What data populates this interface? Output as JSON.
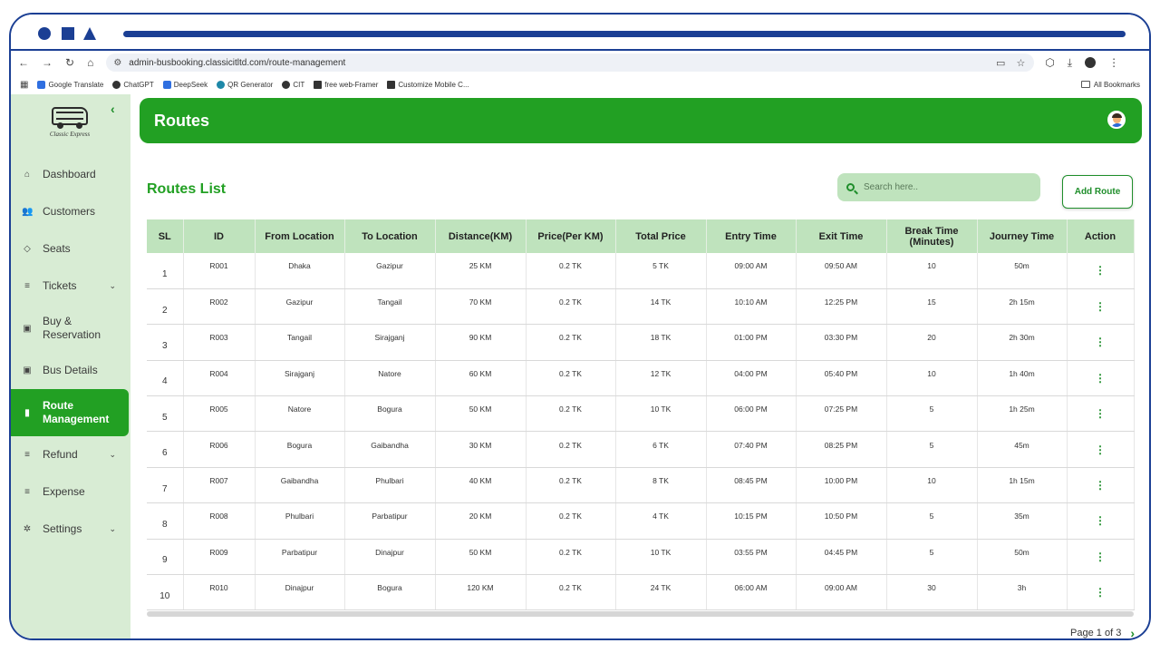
{
  "browser": {
    "url": "admin-busbooking.classicitltd.com/route-management",
    "bookmarks": [
      "Google Translate",
      "ChatGPT",
      "DeepSeek",
      "QR Generator",
      "CIT",
      "free web-Framer",
      "Customize Mobile C..."
    ],
    "all_bookmarks": "All Bookmarks"
  },
  "sidebar": {
    "brand": "Classic Express",
    "items": [
      {
        "label": "Dashboard",
        "icon": "home-icon"
      },
      {
        "label": "Customers",
        "icon": "users-icon"
      },
      {
        "label": "Seats",
        "icon": "layers-icon"
      },
      {
        "label": "Tickets",
        "icon": "list-icon"
      },
      {
        "label": "Buy & Reservation",
        "icon": "bus-icon"
      },
      {
        "label": "Bus Details",
        "icon": "bus-icon"
      },
      {
        "label": "Route Management",
        "icon": "map-icon"
      },
      {
        "label": "Refund",
        "icon": "list-icon"
      },
      {
        "label": "Expense",
        "icon": "list-icon"
      },
      {
        "label": "Settings",
        "icon": "gear-icon"
      }
    ]
  },
  "header": {
    "title": "Routes"
  },
  "main": {
    "list_title": "Routes List",
    "search_placeholder": "Search here..",
    "add_button": "Add Route",
    "pagination": "Page 1 of 3"
  },
  "table": {
    "columns": [
      "SL",
      "ID",
      "From Location",
      "To Location",
      "Distance(KM)",
      "Price(Per KM)",
      "Total Price",
      "Entry Time",
      "Exit Time",
      "Break Time (Minutes)",
      "Journey Time",
      "Action"
    ],
    "rows": [
      [
        "1",
        "R001",
        "Dhaka",
        "Gazipur",
        "25 KM",
        "0.2 TK",
        "5 TK",
        "09:00 AM",
        "09:50 AM",
        "10",
        "50m"
      ],
      [
        "2",
        "R002",
        "Gazipur",
        "Tangail",
        "70 KM",
        "0.2 TK",
        "14 TK",
        "10:10 AM",
        "12:25 PM",
        "15",
        "2h 15m"
      ],
      [
        "3",
        "R003",
        "Tangail",
        "Sirajganj",
        "90 KM",
        "0.2 TK",
        "18 TK",
        "01:00 PM",
        "03:30 PM",
        "20",
        "2h 30m"
      ],
      [
        "4",
        "R004",
        "Sirajganj",
        "Natore",
        "60 KM",
        "0.2 TK",
        "12 TK",
        "04:00 PM",
        "05:40 PM",
        "10",
        "1h 40m"
      ],
      [
        "5",
        "R005",
        "Natore",
        "Bogura",
        "50 KM",
        "0.2 TK",
        "10 TK",
        "06:00 PM",
        "07:25 PM",
        "5",
        "1h 25m"
      ],
      [
        "6",
        "R006",
        "Bogura",
        "Gaibandha",
        "30 KM",
        "0.2 TK",
        "6 TK",
        "07:40 PM",
        "08:25 PM",
        "5",
        "45m"
      ],
      [
        "7",
        "R007",
        "Gaibandha",
        "Phulbari",
        "40 KM",
        "0.2 TK",
        "8 TK",
        "08:45 PM",
        "10:00 PM",
        "10",
        "1h 15m"
      ],
      [
        "8",
        "R008",
        "Phulbari",
        "Parbatipur",
        "20 KM",
        "0.2 TK",
        "4 TK",
        "10:15 PM",
        "10:50 PM",
        "5",
        "35m"
      ],
      [
        "9",
        "R009",
        "Parbatipur",
        "Dinajpur",
        "50 KM",
        "0.2 TK",
        "10 TK",
        "03:55 PM",
        "04:45 PM",
        "5",
        "50m"
      ],
      [
        "10",
        "R010",
        "Dinajpur",
        "Bogura",
        "120 KM",
        "0.2 TK",
        "24 TK",
        "06:00 AM",
        "09:00 AM",
        "30",
        "3h"
      ]
    ]
  },
  "colors": {
    "primary": "#22a023",
    "sidebar_bg": "#d8ecd4",
    "header_row": "#bfe3bd",
    "frame": "#1b3f94"
  }
}
